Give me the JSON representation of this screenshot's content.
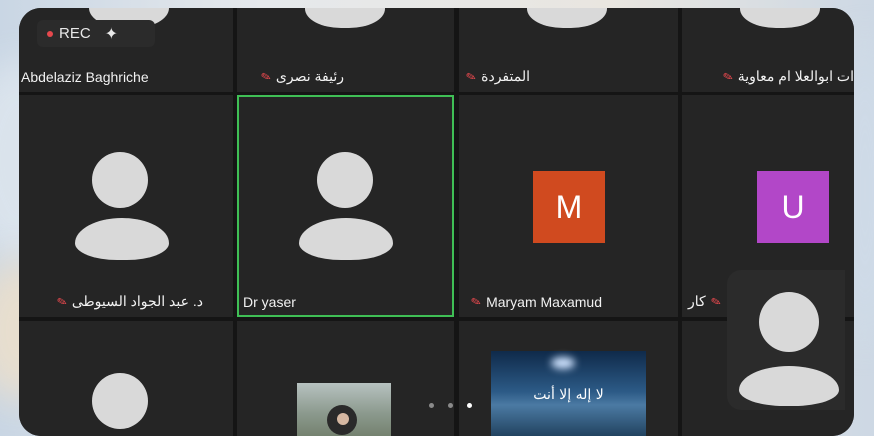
{
  "recording": {
    "label": "REC",
    "icon": "sparkle-icon"
  },
  "participants": [
    {
      "name": "Abdelaziz Baghriche",
      "muted": false
    },
    {
      "name": "رئيفة نصرى",
      "muted": true
    },
    {
      "name": "المتفردة",
      "muted": true
    },
    {
      "name": "ات ابوالعلا ام معاوية",
      "muted": true
    },
    {
      "name": "د. عبد الجواد السيوطى",
      "muted": true
    },
    {
      "name": "Dr yaser",
      "muted": false,
      "active_speaker": true
    },
    {
      "name": "Maryam Maxamud",
      "muted": true,
      "initial": "M",
      "color": "#d04a1f"
    },
    {
      "name": "كار",
      "muted": true,
      "initial": "U",
      "color": "#b247c8"
    }
  ],
  "pager": {
    "pages": 3,
    "current": 3
  },
  "photo_caption": "لا إله إلا أنت",
  "colors": {
    "active_outline": "#3fbf55",
    "mic_muted": "#e5484d"
  }
}
